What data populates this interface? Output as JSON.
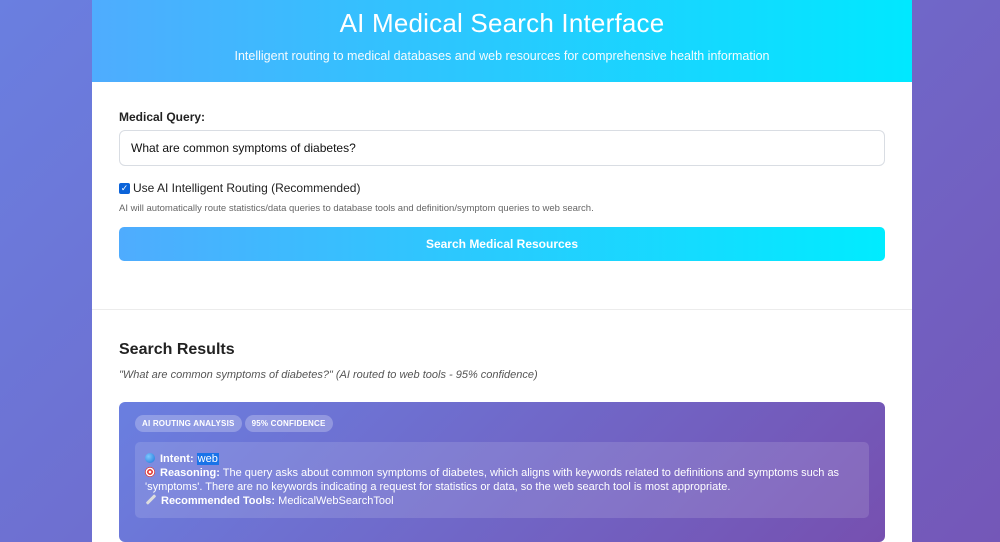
{
  "header": {
    "title": "AI Medical Search Interface",
    "subtitle": "Intelligent routing to medical databases and web resources for comprehensive health information"
  },
  "form": {
    "query_label": "Medical Query:",
    "query_value": "What are common symptoms of diabetes?",
    "routing_label": "Use AI Intelligent Routing (Recommended)",
    "routing_checked": true,
    "routing_help": "AI will automatically route statistics/data queries to database tools and definition/symptom queries to web search.",
    "search_button": "Search Medical Resources"
  },
  "results": {
    "title": "Search Results",
    "echo": "\"What are common symptoms of diabetes?\" (AI routed to web tools - 95% confidence)",
    "analysis": {
      "badge_routing": "AI ROUTING ANALYSIS",
      "badge_confidence": "95% CONFIDENCE",
      "intent_label": "Intent:",
      "intent_value": "web",
      "reasoning_label": "Reasoning:",
      "reasoning_text": "The query asks about common symptoms of diabetes, which aligns with keywords related to definitions and symptoms such as 'symptoms'. There are no keywords indicating a request for statistics or data, so the web search tool is most appropriate.",
      "tools_label": "Recommended Tools:",
      "tools_value": "MedicalWebSearchTool"
    }
  },
  "icons": {
    "intent": "globe-icon",
    "reasoning": "target-icon",
    "tools": "wrench-icon",
    "checkbox": "checkmark-icon"
  },
  "colors": {
    "header_gradient_start": "#4facfe",
    "header_gradient_end": "#00e8ff",
    "background_start": "#6a7fe0",
    "background_end": "#7457b8",
    "checkbox": "#0b63d9"
  }
}
